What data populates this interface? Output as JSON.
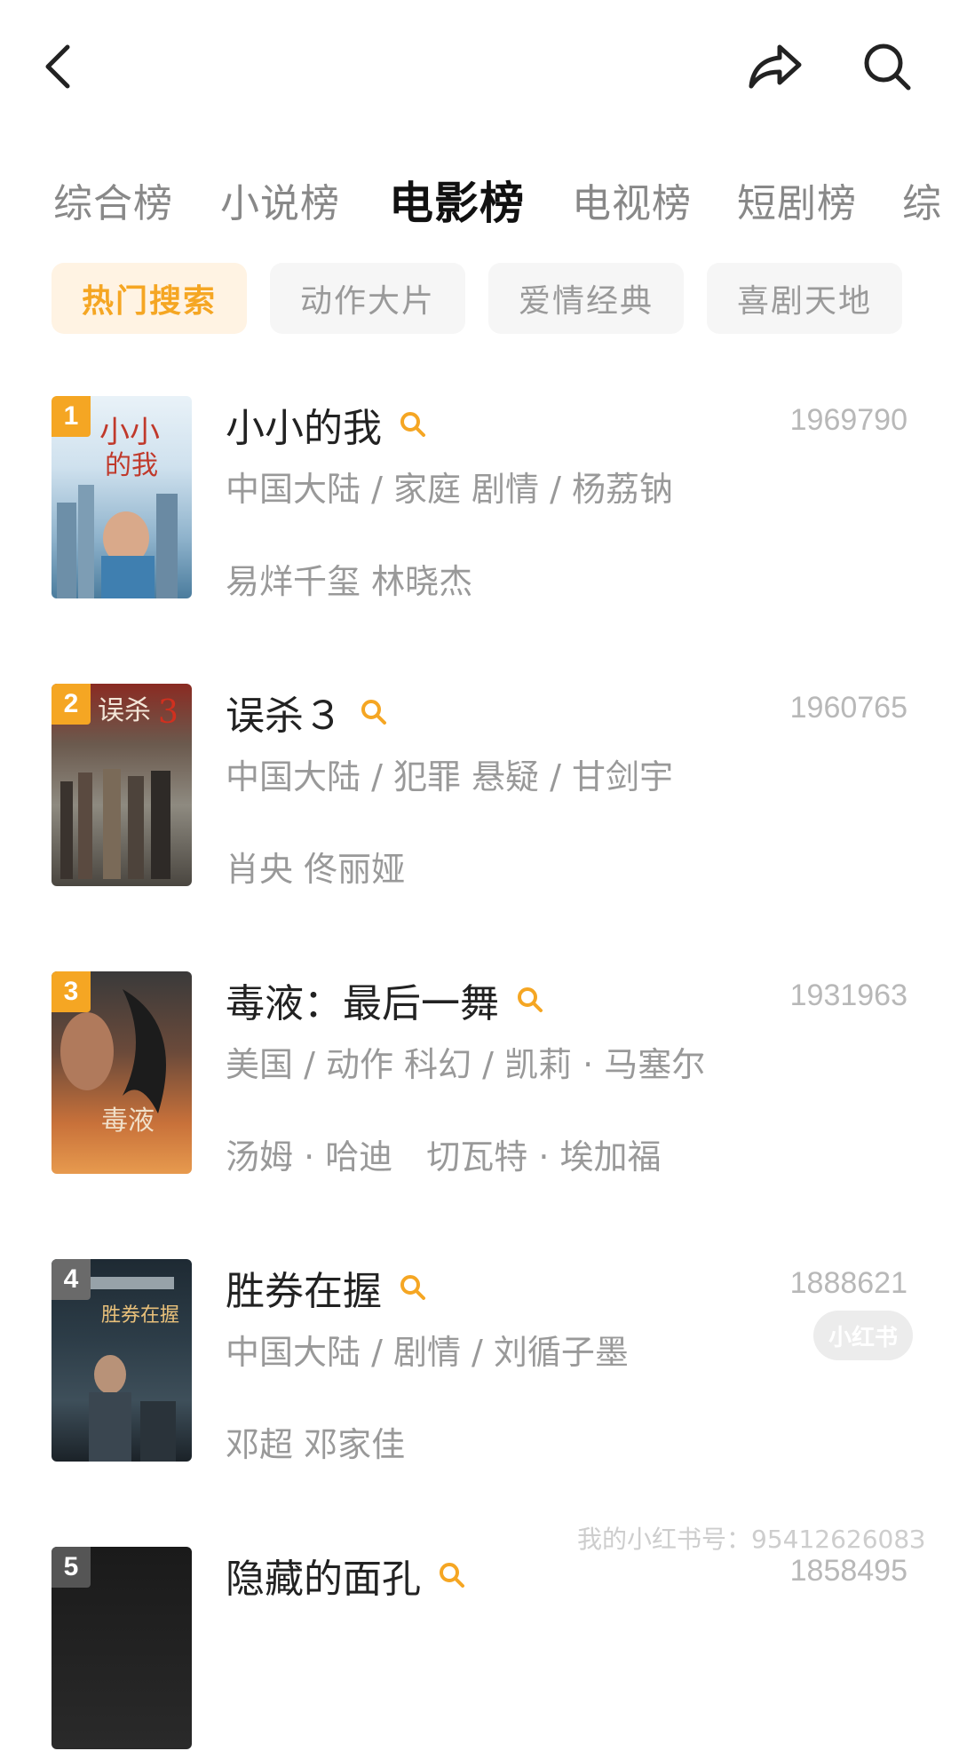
{
  "header": {
    "back_icon": "chevron-left-icon",
    "share_icon": "share-icon",
    "search_icon": "search-icon"
  },
  "tabs": [
    {
      "label": "综合榜",
      "active": false
    },
    {
      "label": "小说榜",
      "active": false
    },
    {
      "label": "电影榜",
      "active": true
    },
    {
      "label": "电视榜",
      "active": false
    },
    {
      "label": "短剧榜",
      "active": false
    },
    {
      "label": "综",
      "active": false
    }
  ],
  "chips": [
    {
      "label": "热门搜索",
      "active": true
    },
    {
      "label": "动作大片",
      "active": false
    },
    {
      "label": "爱情经典",
      "active": false
    },
    {
      "label": "喜剧天地",
      "active": false
    }
  ],
  "items": [
    {
      "rank": "1",
      "title": "小小的我",
      "score": "1969790",
      "meta": "中国大陆 / 家庭 剧情 / 杨荔钠",
      "cast": "易烊千玺 林晓杰"
    },
    {
      "rank": "2",
      "title": "误杀３",
      "score": "1960765",
      "meta": "中国大陆 / 犯罪 悬疑 / 甘剑宇",
      "cast": "肖央 佟丽娅"
    },
    {
      "rank": "3",
      "title": "毒液：最后一舞",
      "score": "1931963",
      "meta": "美国 / 动作 科幻 / 凯莉 · 马塞尔",
      "cast": "汤姆 · 哈迪　切瓦特 · 埃加福"
    },
    {
      "rank": "4",
      "title": "胜券在握",
      "score": "1888621",
      "meta": "中国大陆 / 剧情 / 刘循子墨",
      "cast": "邓超 邓家佳"
    },
    {
      "rank": "5",
      "title": "隐藏的面孔",
      "score": "1858495",
      "meta": "",
      "cast": ""
    }
  ],
  "colors": {
    "accent": "#f5a623",
    "chip_active_bg": "#fff3e3"
  },
  "watermark": {
    "logo": "小红书",
    "text": "我的小红书号：9541262608З"
  }
}
